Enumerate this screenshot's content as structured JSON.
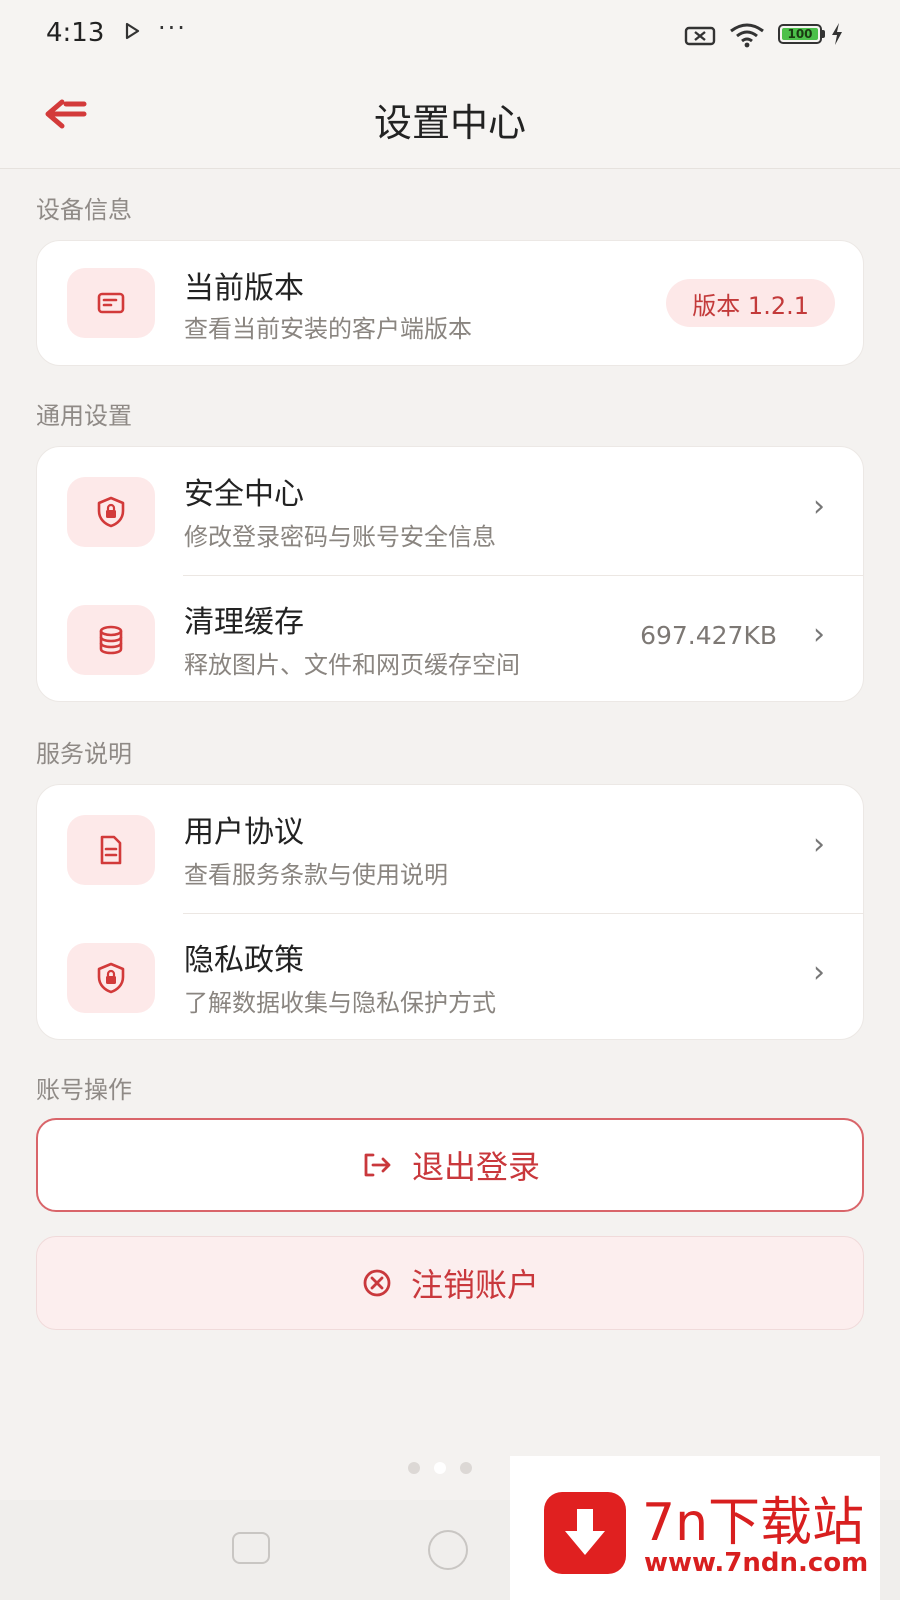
{
  "status_bar": {
    "time": "4:13",
    "more": "···",
    "battery": "100"
  },
  "header": {
    "title": "设置中心"
  },
  "sections": {
    "device": {
      "label": "设备信息"
    },
    "general": {
      "label": "通用设置"
    },
    "service": {
      "label": "服务说明"
    },
    "account": {
      "label": "账号操作"
    }
  },
  "items": {
    "version": {
      "title": "当前版本",
      "subtitle": "查看当前安装的客户端版本",
      "badge": "版本 1.2.1",
      "icon": "id-card-icon"
    },
    "security": {
      "title": "安全中心",
      "subtitle": "修改登录密码与账号安全信息",
      "icon": "shield-lock-icon"
    },
    "cache": {
      "title": "清理缓存",
      "subtitle": "释放图片、文件和网页缓存空间",
      "value": "697.427KB",
      "icon": "database-icon"
    },
    "agreement": {
      "title": "用户协议",
      "subtitle": "查看服务条款与使用说明",
      "icon": "document-icon"
    },
    "privacy": {
      "title": "隐私政策",
      "subtitle": "了解数据收集与隐私保护方式",
      "icon": "shield-lock-icon"
    }
  },
  "actions": {
    "logout": "退出登录",
    "delete_account": "注销账户"
  },
  "watermark": {
    "name": "7n下载站",
    "url": "www.7ndn.com"
  },
  "colors": {
    "accent": "#c9383c",
    "icon_bg": "#fde9e9",
    "page_bg": "#f4f2f0"
  }
}
